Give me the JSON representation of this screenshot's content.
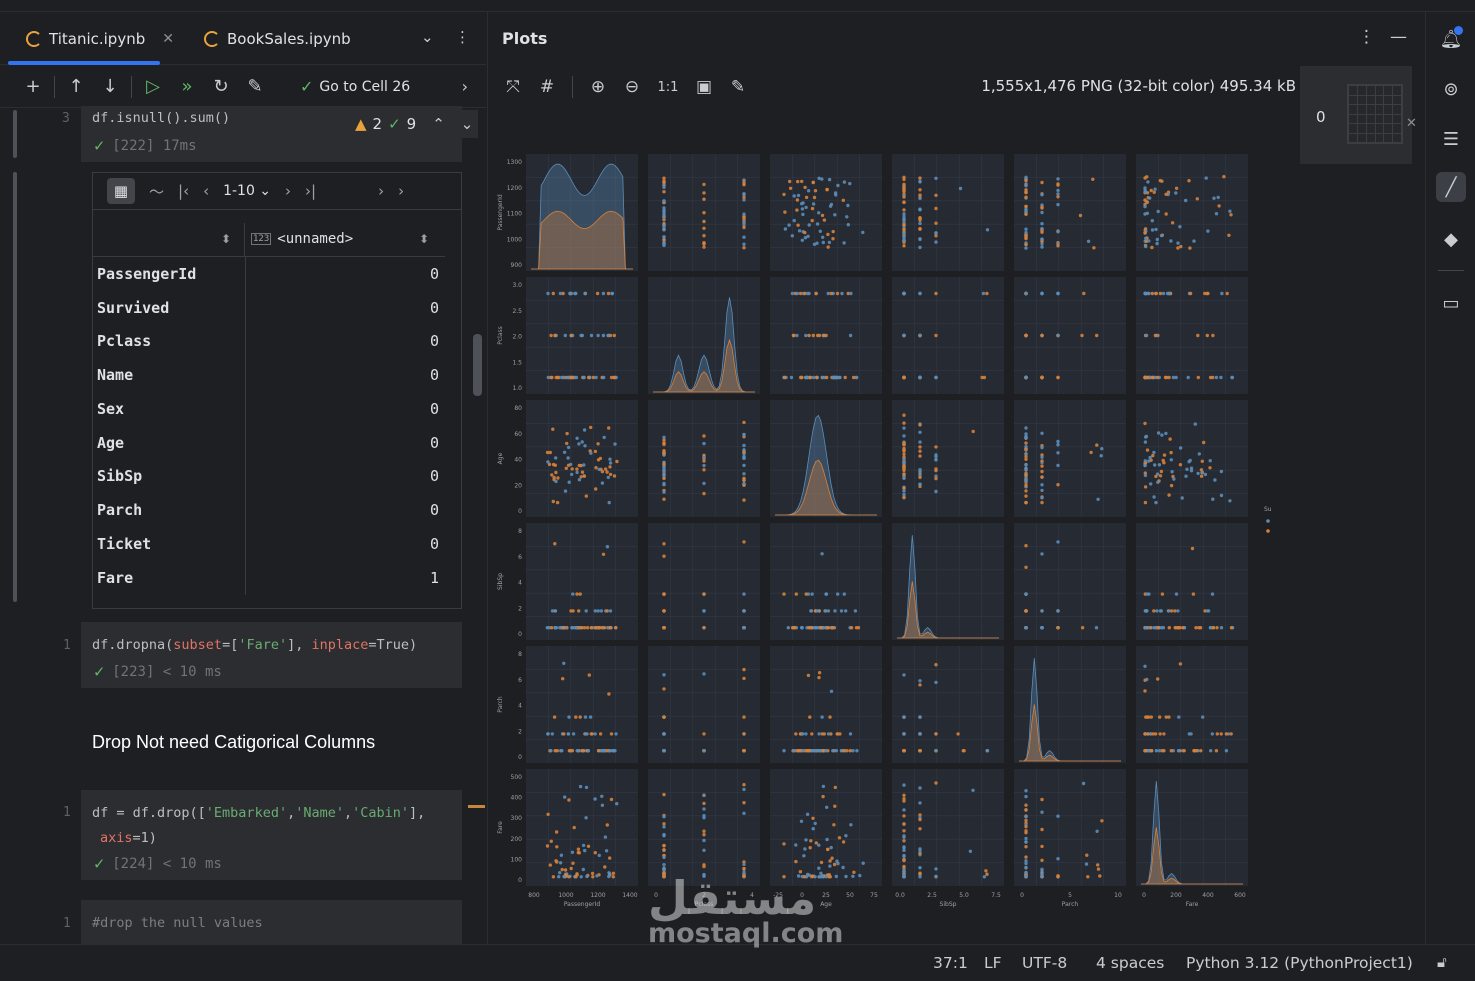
{
  "tabs": [
    {
      "label": "Titanic.ipynb",
      "active": true
    },
    {
      "label": "BookSales.ipynb",
      "active": false
    }
  ],
  "toolbar": {
    "goto_label": "Go to Cell 26"
  },
  "inspections": {
    "warnings": "2",
    "ok": "9"
  },
  "cells": {
    "c3": {
      "line": "3",
      "code": "df.isnull().sum()",
      "status": "[222] 17ms"
    },
    "c4": {
      "line": "1",
      "code_prefix": "df.dropna(",
      "param": "subset",
      "code_eq": "=[",
      "str": "'Fare'",
      "code_mid": "], ",
      "param2": "inplace",
      "code_end": "=True)",
      "status": "[223] < 10 ms"
    },
    "c5": {
      "line": "1",
      "l1_a": "df = df.drop([",
      "s1": "'Embarked'",
      "comma1": ",",
      "s2": "'Name'",
      "comma2": ",",
      "s3": "'Cabin'",
      "l1_b": "],",
      "param": "axis",
      "l2_b": "=1)",
      "status": "[224] < 10 ms"
    },
    "c6": {
      "line": "1",
      "comment": "#drop the null values"
    }
  },
  "markdown": {
    "heading": "Drop Not need Catigorical Columns"
  },
  "dataframe": {
    "pager": "1-10",
    "column": "<unnamed>",
    "type_icon": "123",
    "rows": [
      {
        "index": "PassengerId",
        "value": "0"
      },
      {
        "index": "Survived",
        "value": "0"
      },
      {
        "index": "Pclass",
        "value": "0"
      },
      {
        "index": "Name",
        "value": "0"
      },
      {
        "index": "Sex",
        "value": "0"
      },
      {
        "index": "Age",
        "value": "0"
      },
      {
        "index": "SibSp",
        "value": "0"
      },
      {
        "index": "Parch",
        "value": "0"
      },
      {
        "index": "Ticket",
        "value": "0"
      },
      {
        "index": "Fare",
        "value": "1"
      }
    ]
  },
  "plots": {
    "title": "Plots",
    "zoom_label": "1:1",
    "image_info": "1,555x1,476 PNG (32-bit color) 495.34 kB",
    "thumb_count": "0",
    "variables": [
      "PassengerId",
      "Pclass",
      "Age",
      "SibSp",
      "Parch",
      "Fare"
    ],
    "legend_title": "Survived",
    "legend_items": [
      "0",
      "1"
    ],
    "colors": {
      "survived_0": "#5b8db8",
      "survived_1": "#d6813a"
    },
    "tick_labels": {
      "PassengerId": {
        "y": [
          "1300",
          "1200",
          "1100",
          "1000",
          "900"
        ],
        "x": [
          "800",
          "1000",
          "1200",
          "1400"
        ]
      },
      "Pclass": {
        "y": [
          "3.0",
          "2.5",
          "2.0",
          "1.5",
          "1.0"
        ],
        "x": [
          "0",
          "2",
          "4"
        ]
      },
      "Age": {
        "y": [
          "80",
          "60",
          "40",
          "20",
          "0"
        ],
        "x": [
          "-25",
          "0",
          "25",
          "50",
          "75"
        ]
      },
      "SibSp": {
        "y": [
          "8",
          "6",
          "4",
          "2",
          "0"
        ],
        "x": [
          "0.0",
          "2.5",
          "5.0",
          "7.5"
        ]
      },
      "Parch": {
        "y": [
          "8",
          "6",
          "4",
          "2",
          "0"
        ],
        "x": [
          "0",
          "5",
          "10"
        ]
      },
      "Fare": {
        "y": [
          "500",
          "400",
          "300",
          "200",
          "100",
          "0"
        ],
        "x": [
          "0",
          "200",
          "400",
          "600"
        ]
      }
    }
  },
  "statusbar": {
    "position": "37:1",
    "line_sep": "LF",
    "encoding": "UTF-8",
    "indent": "4 spaces",
    "interpreter": "Python 3.12 (PythonProject1)"
  },
  "watermark": {
    "arabic": "مستقل",
    "latin": "mostaql.com"
  }
}
